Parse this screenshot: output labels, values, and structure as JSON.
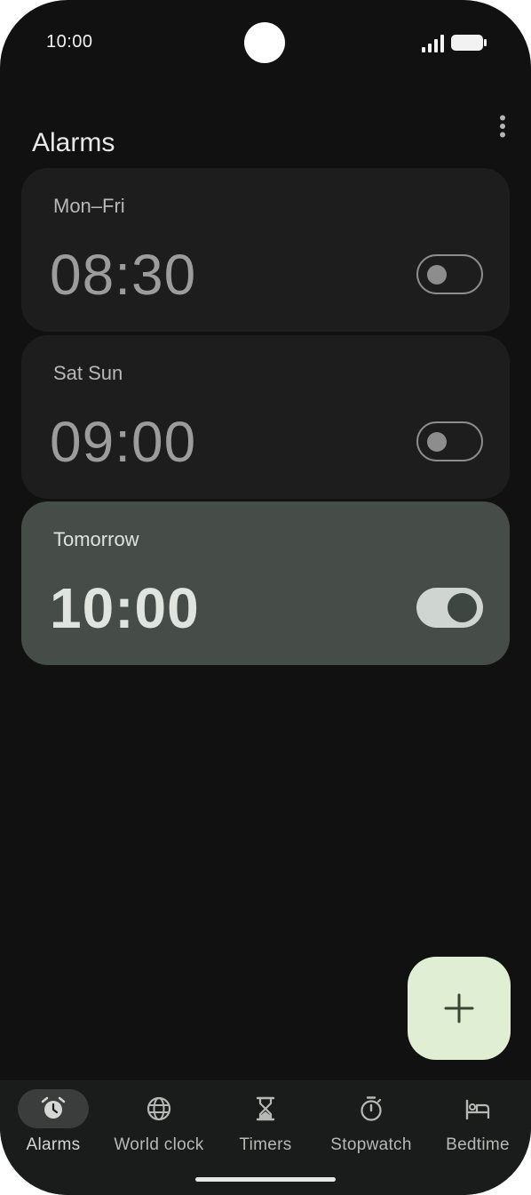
{
  "status_bar": {
    "time": "10:00",
    "icons": [
      "signal-icon",
      "battery-icon"
    ]
  },
  "header": {
    "title": "Alarms",
    "menu_icon": "more-vert-icon"
  },
  "alarms": [
    {
      "days": "Mon–Fri",
      "time": "08:30",
      "enabled": false
    },
    {
      "days": "Sat Sun",
      "time": "09:00",
      "enabled": false
    },
    {
      "days": "Tomorrow",
      "time": "10:00",
      "enabled": true
    }
  ],
  "fab": {
    "icon": "plus-icon"
  },
  "bottom_nav": {
    "active": "Alarms",
    "items": [
      {
        "label": "Alarms",
        "icon": "alarm-clock-icon"
      },
      {
        "label": "World clock",
        "icon": "globe-icon"
      },
      {
        "label": "Timers",
        "icon": "hourglass-icon"
      },
      {
        "label": "Stopwatch",
        "icon": "stopwatch-icon"
      },
      {
        "label": "Bedtime",
        "icon": "bed-icon"
      }
    ]
  },
  "colors": {
    "background": "#111111",
    "card": "#1d1d1d",
    "card_active": "#464d49",
    "fab": "#e0efd3",
    "nav_background": "#1a1c1b"
  }
}
